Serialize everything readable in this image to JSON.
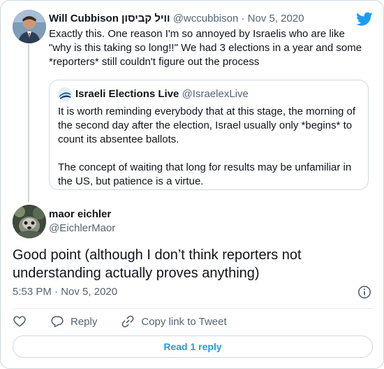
{
  "parent_tweet": {
    "display_name": "Will Cubbison וויל קביסון",
    "handle": "@wccubbison",
    "separator": "·",
    "date": "Nov 5, 2020",
    "text": "Exactly this. One reason I'm so annoyed by Israelis who are like \"why is this taking so long!!\" We had 3 elections in a year and some *reporters* still couldn't figure out the process"
  },
  "quoted_tweet": {
    "display_name": "Israeli Elections Live",
    "handle": "@IsraelexLive",
    "paragraphs": [
      "It is worth reminding everybody that at this stage, the morning of the second day after the election, Israel usually only *begins* to count its absentee ballots.",
      "The concept of waiting that long for results may be unfamiliar in the US, but patience is a virtue."
    ]
  },
  "main_tweet": {
    "display_name": "maor eichler",
    "handle": "@EichlerMaor",
    "text": "Good point (although I don’t think reporters not understanding actually proves anything)",
    "time": "5:53 PM",
    "separator": "·",
    "date": "Nov 5, 2020"
  },
  "actions": {
    "reply_label": "Reply",
    "copy_link_label": "Copy link to Tweet"
  },
  "read_replies_label": "Read 1 reply",
  "icons": {
    "brand": "twitter-bird-icon",
    "like": "heart-icon",
    "reply": "speech-bubble-icon",
    "copy": "link-icon",
    "info": "info-icon"
  },
  "colors": {
    "accent": "#1d9bf0",
    "secondary_text": "#536471",
    "border": "#cfd9de"
  }
}
